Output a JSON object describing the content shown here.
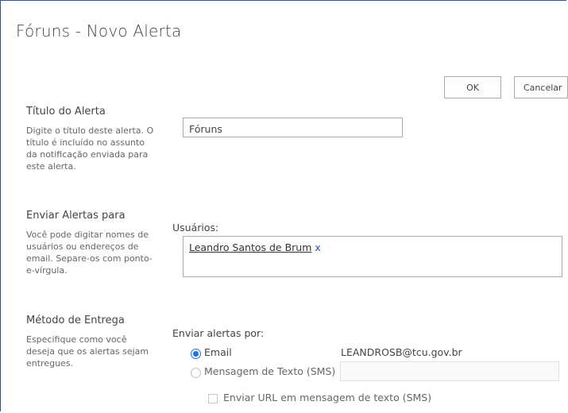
{
  "page": {
    "title": "Fóruns - Novo Alerta"
  },
  "toolbar": {
    "ok_label": "OK",
    "cancel_label": "Cancelar"
  },
  "alert_title": {
    "heading": "Título do Alerta",
    "description": "Digite o título deste alerta. O título é incluído no assunto da notificação enviada para este alerta.",
    "value": "Fóruns"
  },
  "send_to": {
    "heading": "Enviar Alertas para",
    "description": "Você pode digitar nomes de usuários ou endereços de email. Separe-os com ponto-e-vírgula.",
    "users_label": "Usuários:",
    "users": [
      {
        "name": "Leandro Santos de Brum",
        "remove": "x"
      }
    ]
  },
  "delivery": {
    "heading": "Método de Entrega",
    "description": "Especifique como você deseja que os alertas sejam entregues.",
    "send_by_label": "Enviar alertas por:",
    "email_label": "Email",
    "email_address": "LEANDROSB@tcu.gov.br",
    "sms_label": "Mensagem de Texto (SMS)",
    "sms_value": "",
    "sms_url_label": "Enviar URL em mensagem de texto (SMS)",
    "selected": "email"
  }
}
